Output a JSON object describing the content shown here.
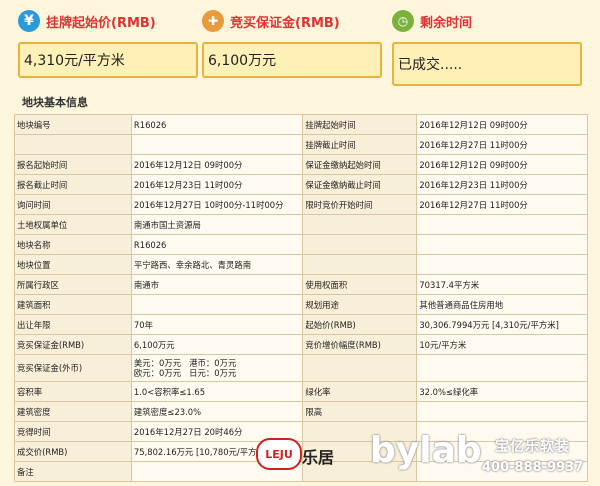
{
  "cards": [
    {
      "label": "挂牌起始价(RMB)",
      "value": "4,310元/平方米",
      "icon": "currency-icon",
      "color": "#2a9bd9"
    },
    {
      "label": "竞买保证金(RMB)",
      "value": "6,100万元",
      "icon": "deposit-icon",
      "color": "#e89a3c"
    },
    {
      "label": "剩余时间",
      "value": "已成交.....",
      "icon": "alarm-clock-icon",
      "color": "#7bb33a"
    }
  ],
  "section_title": "地块基本信息",
  "rows": [
    [
      "地块编号",
      "R16026",
      "挂牌起始时间",
      "2016年12月12日 09时00分"
    ],
    [
      "",
      "",
      "挂牌截止时间",
      "2016年12月27日 11时00分"
    ],
    [
      "报名起始时间",
      "2016年12月12日 09时00分",
      "保证金缴纳起始时间",
      "2016年12月12日 09时00分"
    ],
    [
      "报名截止时间",
      "2016年12月23日 11时00分",
      "保证金缴纳截止时间",
      "2016年12月23日 11时00分"
    ],
    [
      "询问时间",
      "2016年12月27日 10时00分-11时00分",
      "限时竞价开始时间",
      "2016年12月27日 11时00分"
    ],
    [
      "土地权属单位",
      "南通市国土资源局",
      "",
      ""
    ],
    [
      "地块名称",
      "R16026",
      "",
      ""
    ],
    [
      "地块位置",
      "平宁路西、幸余路北、青灵路南",
      "",
      ""
    ],
    [
      "所属行政区",
      "南通市",
      "使用权面积",
      "70317.4平方米"
    ],
    [
      "建筑面积",
      "",
      "规划用途",
      "其他普通商品住房用地"
    ],
    [
      "出让年限",
      "70年",
      "起始价(RMB)",
      "30,306.7994万元 [4,310元/平方米]"
    ],
    [
      "竞买保证金(RMB)",
      "6,100万元",
      "竞价增价幅度(RMB)",
      "10元/平方米"
    ],
    [
      "竞买保证金(外币)",
      "美元：0万元   港币：0万元\n欧元：0万元   日元：0万元",
      "",
      ""
    ],
    [
      "容积率",
      "1.0<容积率≤1.65",
      "绿化率",
      "32.0%≤绿化率"
    ],
    [
      "建筑密度",
      "建筑密度≤23.0%",
      "限高",
      ""
    ],
    [
      "竞得时间",
      "2016年12月27日 20时46分",
      "",
      ""
    ],
    [
      "成交价(RMB)",
      "75,802.16万元 [10,780元/平方米]",
      "",
      ""
    ],
    [
      "备注",
      "",
      "",
      ""
    ]
  ],
  "watermark": {
    "leju": "LEJU",
    "leju_cn": "乐居",
    "bylab": "bylab",
    "brand_cn": "宝亿乐软装",
    "phone": "400-888-9937"
  }
}
